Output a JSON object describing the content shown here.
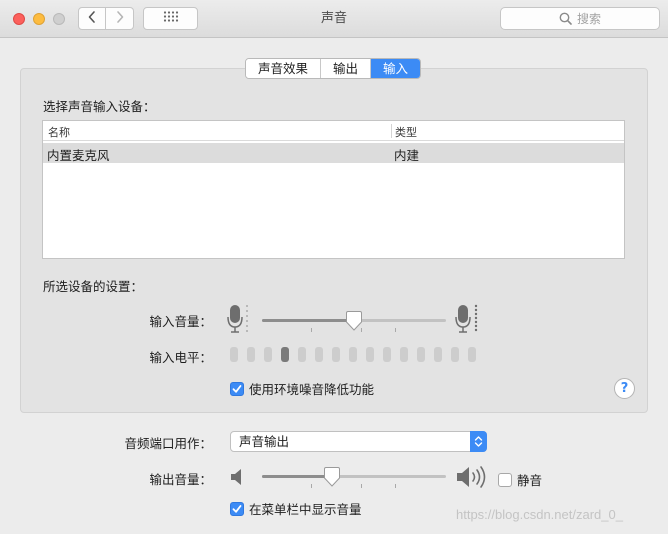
{
  "window": {
    "title": "声音",
    "search_placeholder": "搜索"
  },
  "tabs": [
    {
      "label": "声音效果",
      "active": false
    },
    {
      "label": "输出",
      "active": false
    },
    {
      "label": "输入",
      "active": true
    }
  ],
  "input_tab": {
    "device_section_title": "选择声音输入设备：",
    "table": {
      "columns": [
        "名称",
        "类型"
      ],
      "rows": [
        {
          "name": "内置麦克风",
          "type": "内建",
          "selected": true
        }
      ]
    },
    "settings_title": "所选设备的设置：",
    "input_volume_label": "输入音量：",
    "input_volume_level": 0.5,
    "input_level_label": "输入电平：",
    "input_level_segments_total": 15,
    "input_level_segments_lit": 1,
    "noise_reduction": {
      "label": "使用环境噪音降低功能",
      "checked": true
    }
  },
  "output_section": {
    "port_label": "音频端口用作：",
    "port_value": "声音输出",
    "output_volume_label": "输出音量：",
    "output_volume_level": 0.38,
    "mute": {
      "label": "静音",
      "checked": false
    },
    "show_in_menubar": {
      "label": "在菜单栏中显示音量",
      "checked": true
    }
  },
  "watermark": "https://blog.csdn.net/zard_0_",
  "colors": {
    "accent": "#3c8bf5",
    "close": "#fc605c",
    "minimize": "#fdbc40",
    "zoom": "#cfcfcf"
  }
}
